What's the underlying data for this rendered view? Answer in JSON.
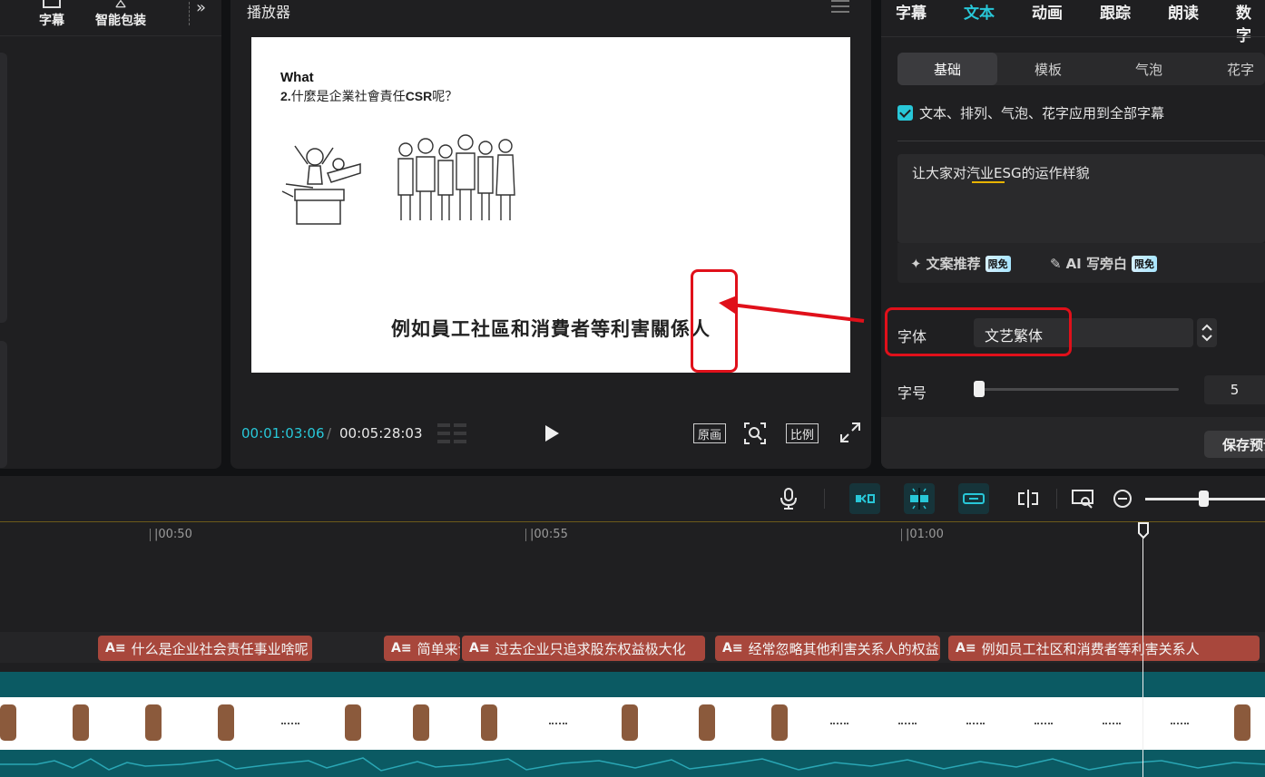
{
  "left_panel": {
    "tabs": [
      {
        "label": "字幕",
        "icon": "subtitle-icon"
      },
      {
        "label": "智能包装",
        "icon": "warning-icon"
      }
    ],
    "expand_icon": "»"
  },
  "player": {
    "title": "播放器",
    "slide": {
      "what": "What",
      "question_num": "2.",
      "question_text": "什麼是企業社會責任",
      "question_abbr": "CSR",
      "question_end": "呢？",
      "subtitle": "例如員工社區和消費者等利害關係人"
    },
    "time_current": "00:01:03:06",
    "time_sep": "/",
    "time_total": "00:05:28:03",
    "buttons": {
      "original": "原画",
      "ratio": "比例"
    }
  },
  "right_panel": {
    "tabs": [
      "字幕",
      "文本",
      "动画",
      "跟踪",
      "朗读",
      "数字"
    ],
    "active_tab": "文本",
    "subtabs": [
      "基础",
      "模板",
      "气泡",
      "花字"
    ],
    "apply_all_label": "文本、排列、气泡、花字应用到全部字幕",
    "text_content": "让大家对汽业ESG的运作样貌",
    "ai_copy": "文案推荐",
    "ai_narration": "AI 写旁白",
    "badge": "限免",
    "font_label": "字体",
    "font_value": "文艺繁体",
    "size_label": "字号",
    "size_value": "5",
    "save_preset": "保存预设"
  },
  "timeline": {
    "ticks": [
      "|00:50",
      "|00:55",
      "|01:00"
    ],
    "subtitle_clips": [
      "什么是企业社会责任事业啥呢",
      "简单来说",
      "过去企业只追求股东权益极大化",
      "经常忽略其他利害关系人的权益",
      "例如员工社区和消费者等利害关系人"
    ],
    "clip_icon": "A≡"
  },
  "colors": {
    "accent": "#28c7d8",
    "annotation_red": "#e0101a",
    "subtitle_clip": "#a8473c",
    "video_track": "#0b5a63"
  }
}
